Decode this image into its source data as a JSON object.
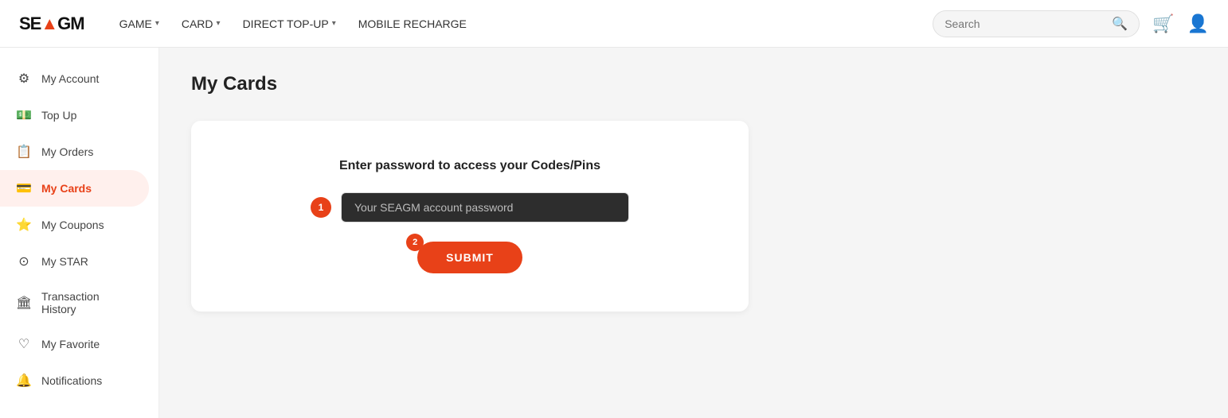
{
  "header": {
    "logo": "SE▲GM",
    "logo_highlight": "▲",
    "nav_items": [
      {
        "label": "GAME",
        "has_dropdown": true
      },
      {
        "label": "CARD",
        "has_dropdown": true
      },
      {
        "label": "DIRECT TOP-UP",
        "has_dropdown": true
      },
      {
        "label": "MOBILE RECHARGE",
        "has_dropdown": false
      }
    ],
    "search_placeholder": "Search",
    "cart_icon": "🛒",
    "account_icon": "👤"
  },
  "sidebar": {
    "items": [
      {
        "label": "My Account",
        "icon": "⚙",
        "active": false,
        "id": "account"
      },
      {
        "label": "Top Up",
        "icon": "💵",
        "active": false,
        "id": "topup"
      },
      {
        "label": "My Orders",
        "icon": "📋",
        "active": false,
        "id": "orders"
      },
      {
        "label": "My Cards",
        "icon": "💳",
        "active": true,
        "id": "cards"
      },
      {
        "label": "My Coupons",
        "icon": "⭐",
        "active": false,
        "id": "coupons"
      },
      {
        "label": "My STAR",
        "icon": "⊙",
        "active": false,
        "id": "star"
      },
      {
        "label": "Transaction History",
        "icon": "🏛",
        "active": false,
        "id": "history"
      },
      {
        "label": "My Favorite",
        "icon": "♡",
        "active": false,
        "id": "favorite"
      },
      {
        "label": "Notifications",
        "icon": "🔔",
        "active": false,
        "id": "notifications"
      }
    ]
  },
  "main": {
    "page_title": "My Cards",
    "card_panel": {
      "title": "Enter password to access your Codes/Pins",
      "password_placeholder": "Your SEAGM account password",
      "step1_label": "1",
      "step2_label": "2",
      "submit_label": "SUBMIT"
    }
  }
}
